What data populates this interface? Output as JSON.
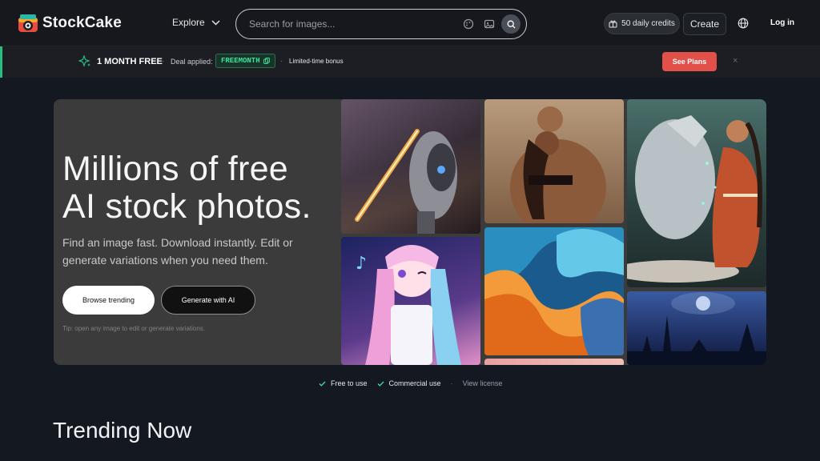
{
  "header": {
    "logo_text": "StockCake",
    "explore_label": "Explore",
    "search_placeholder": "Search for images...",
    "credits_label": "50 daily credits",
    "create_label": "Create",
    "login_label": "Log in"
  },
  "promo": {
    "title": "1 MONTH FREE",
    "deal_label": "Deal applied:",
    "code": "FREEMONTH",
    "bonus": "Limited-time bonus",
    "cta": "See Plans",
    "close": "×",
    "separator": "·"
  },
  "hero": {
    "title_line1": "Millions of free",
    "title_line2": "AI stock photos.",
    "subtitle": "Find an image fast. Download instantly. Edit or generate variations when you need them.",
    "btn_trending": "Browse trending",
    "btn_ai": "Generate with AI",
    "tip": "Tip: open any image to edit or generate variations."
  },
  "features": {
    "free": "Free to use",
    "commercial": "Commercial use",
    "license": "View license",
    "separator": "·"
  },
  "trending_title": "Trending Now",
  "colors": {
    "accent_red": "#e2504a",
    "code_green": "#3ee09a",
    "promo_bar": "#2bbd7e"
  }
}
